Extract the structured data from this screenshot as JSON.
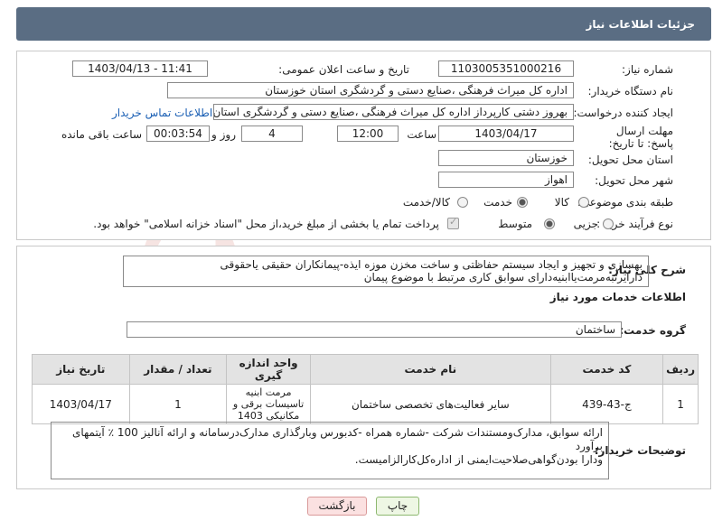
{
  "header": {
    "title": "جزئیات اطلاعات نیاز"
  },
  "form": {
    "need_number_label": "شماره نیاز:",
    "need_number": "1103005351000216",
    "announce_label": "تاریخ و ساعت اعلان عمومی:",
    "announce_value": "1403/04/13 - 11:41",
    "buyer_org_label": "نام دستگاه خریدار:",
    "buyer_org": "اداره کل میراث فرهنگی ،صنایع دستی و گردشگری استان خوزستان",
    "creator_label": "ایجاد کننده درخواست:",
    "creator": "بهروز دشتی کارپرداز اداره کل میراث فرهنگی ،صنایع دستی و گردشگری استان خوزستان",
    "contact_link": "اطلاعات تماس خریدار",
    "deadline_label": "مهلت ارسال پاسخ: تا تاریخ:",
    "deadline_date": "1403/04/17",
    "time_label": "ساعت",
    "deadline_time": "12:00",
    "days_value": "4",
    "days_label": "روز و",
    "remaining_time": "00:03:54",
    "remaining_label": "ساعت باقی مانده",
    "province_label": "استان محل تحویل:",
    "province": "خوزستان",
    "city_label": "شهر محل تحویل:",
    "city": "اهواز",
    "category_label": "طبقه بندی موضوعی:",
    "category_options": [
      "کالا",
      "خدمت",
      "کالا/خدمت"
    ],
    "category_selected": "خدمت",
    "process_label": "نوع فرآیند خرید :",
    "process_options": [
      "جزیی",
      "متوسط"
    ],
    "process_selected": "متوسط",
    "payment_note": "پرداخت تمام یا بخشی از مبلغ خرید،از محل \"اسناد خزانه اسلامی\" خواهد بود."
  },
  "summary": {
    "label": "شرح کلی نیاز:",
    "text_line1": "بهسازی و تجهیز و ایجاد سیستم حفاظتی و ساخت مخزن موزه ایذه-پیمانکاران حقیقی یاحقوقی",
    "text_line2": "دارایرتبه‌مرمت‌یاابنیه‌دارای سوابق کاری مرتبط با موضوع پیمان"
  },
  "services": {
    "section_title": "اطلاعات خدمات مورد نیاز",
    "group_label": "گروه خدمت:",
    "group_value": "ساختمان",
    "columns": [
      "ردیف",
      "کد خدمت",
      "نام خدمت",
      "واحد اندازه گیری",
      "تعداد / مقدار",
      "تاریخ نیاز"
    ],
    "rows": [
      {
        "row": "1",
        "code": "ج-43-439",
        "name": "سایر فعالیت‌های تخصصی ساختمان",
        "unit": "مرمت ابنیه تاسیسات برقی و مکانیکی 1403",
        "qty": "1",
        "date": "1403/04/17"
      }
    ]
  },
  "buyer_notes": {
    "label": "توضیحات خریدار:",
    "line1": "ارائه سوابق، مدارک‌ومستندات شرکت -شماره همراه -کدبورس وبارگذاری مدارک‌درسامانه و ارائه آنالیز 100 ٪ آیتمهای برآورد",
    "line2": "ودارا بودن‌گواهی‌صلاحیت‌ایمنی از اداره‌کل‌کارالزامیست."
  },
  "buttons": {
    "print": "چاپ",
    "back": "بازگشت"
  },
  "watermark": {
    "text": "AriaTender.net"
  }
}
